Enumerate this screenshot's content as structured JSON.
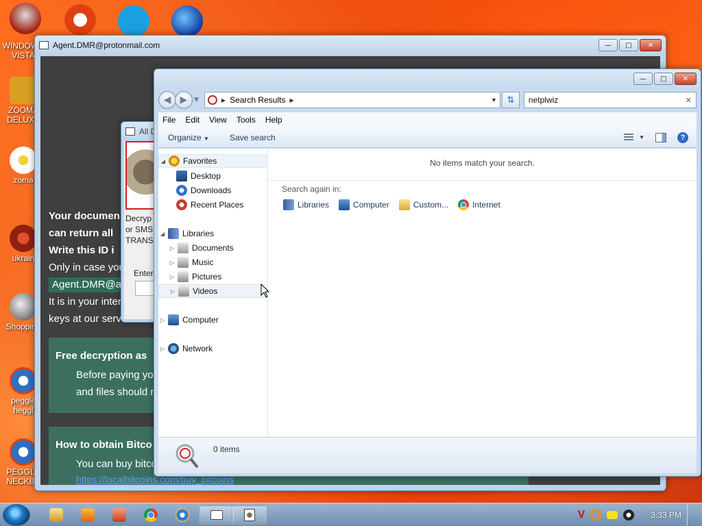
{
  "desktop": {
    "icons": [
      {
        "label": "WINDOWS VISTA",
        "color": "#c0392b"
      },
      {
        "label": "ZOOMA DELUXE",
        "color": "#d8a020"
      },
      {
        "label": "zoma",
        "color": "#f3f3f3"
      },
      {
        "label": "ukrain",
        "color": "#b03020"
      },
      {
        "label": "Shopping",
        "color": "#6b6b6b"
      },
      {
        "label": "peggle heggl",
        "color": "#3070c0"
      },
      {
        "label": "PEGGLE NECKBE",
        "color": "#3070c0"
      }
    ]
  },
  "ransom_window": {
    "title": "Agent.DMR@protonmail.com",
    "lines": {
      "l1": "Your documen",
      "l2": "can return all",
      "l3": "Write this ID i",
      "l4": "Only in case you",
      "id": "Agent.DMR@ad",
      "l5": "It is in your inter",
      "l6": "keys at our serv"
    },
    "box1": {
      "heading": "Free decryption as",
      "t1": "Before paying you",
      "t2": "and files should no"
    },
    "box2": {
      "heading": "How to obtain Bitco",
      "t1": "You can buy bitco"
    },
    "link": "https://localbitcoins.com/buy_bitcoins"
  },
  "dialog": {
    "title": "All D",
    "lines": [
      "Decryp",
      "or SMS",
      "TRANS"
    ],
    "enter_label": "Enter"
  },
  "explorer": {
    "address": {
      "crumb": "Search Results"
    },
    "search": {
      "value": "netplwiz"
    },
    "menu": [
      "File",
      "Edit",
      "View",
      "Tools",
      "Help"
    ],
    "commands": {
      "organize": "Organize",
      "save_search": "Save search"
    },
    "nav": {
      "favorites": {
        "label": "Favorites",
        "items": [
          "Desktop",
          "Downloads",
          "Recent Places"
        ]
      },
      "libraries": {
        "label": "Libraries",
        "items": [
          "Documents",
          "Music",
          "Pictures",
          "Videos"
        ]
      },
      "computer": "Computer",
      "network": "Network"
    },
    "content": {
      "empty_message": "No items match your search.",
      "search_again": "Search again in:",
      "locations": [
        "Libraries",
        "Computer",
        "Custom...",
        "Internet"
      ]
    },
    "details": {
      "count": "0 items"
    }
  },
  "taskbar": {
    "clock": "3:33 PM"
  },
  "colors": {
    "accent": "#2b6ac8",
    "ransom_bg": "#3f3f3f",
    "ransom_box": "#3d6f60"
  }
}
